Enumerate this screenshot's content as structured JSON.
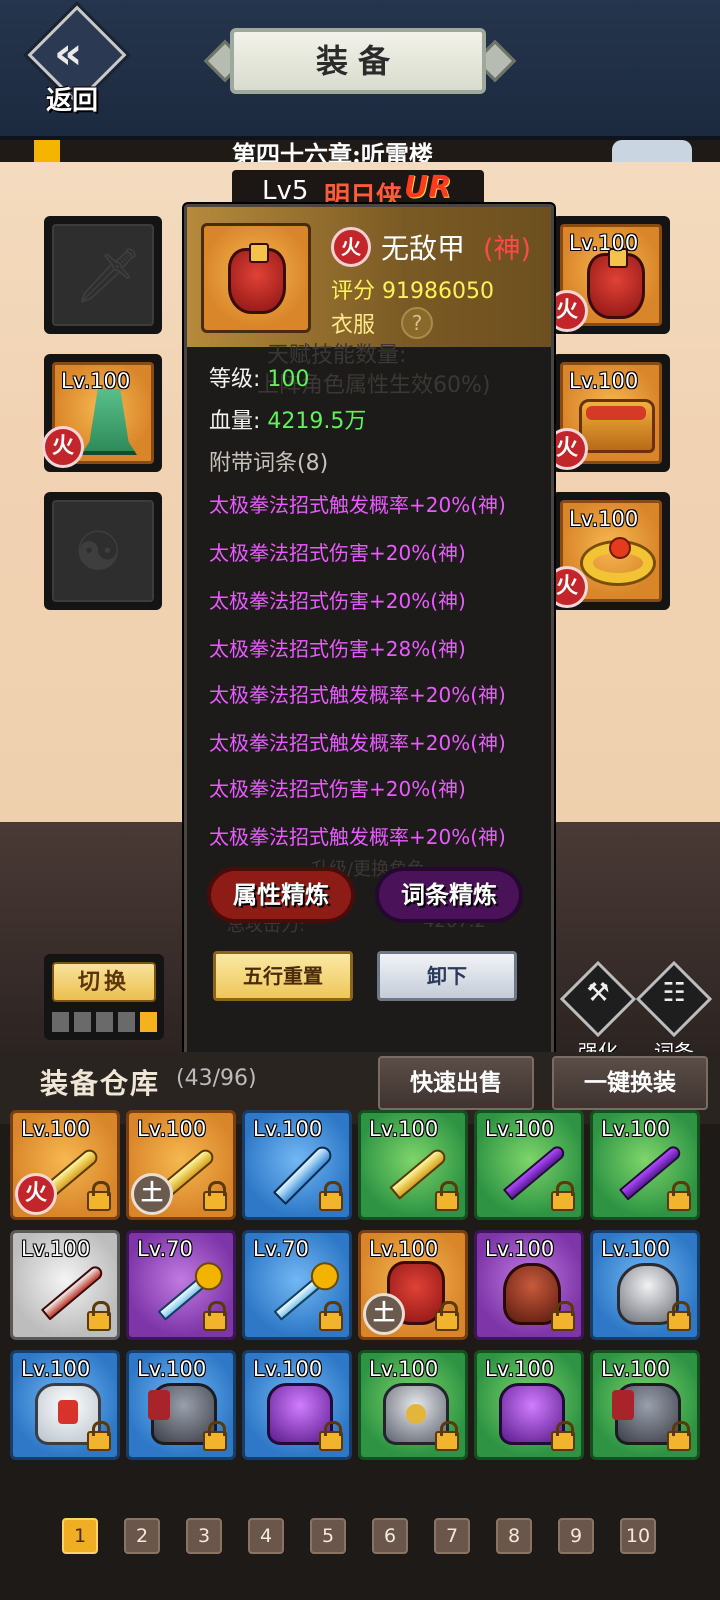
{
  "header": {
    "back_label": "返回",
    "title": "装备",
    "chapter_text": "第四十六章:听雷楼"
  },
  "hero": {
    "level": "Lv5",
    "name": "明日侠",
    "rank": "UR"
  },
  "slots": {
    "left": [
      {
        "state": "empty",
        "icon": "dagger-placeholder-icon"
      },
      {
        "state": "filled",
        "level": "Lv.100",
        "icon": "hat-icon",
        "element": "火"
      },
      {
        "state": "empty",
        "icon": "amulet-placeholder-icon"
      }
    ],
    "right": [
      {
        "state": "filled",
        "level": "Lv.100",
        "icon": "armor-icon",
        "element": "火"
      },
      {
        "state": "filled",
        "level": "Lv.100",
        "icon": "boots-icon",
        "element": "火"
      },
      {
        "state": "filled",
        "level": "Lv.100",
        "icon": "ring-icon",
        "element": "火"
      }
    ]
  },
  "detail": {
    "element": "火",
    "name": "无敌甲",
    "grade": "(神)",
    "score_label": "评分",
    "score_value": "91986050",
    "type": "衣服",
    "help": "?",
    "level_label": "等级:",
    "level_value": "100",
    "hp_label": "血量:",
    "hp_value": "4219.5万",
    "ghost_text_1": "天赋技能数量:",
    "ghost_text_2": "上阵角色属性生效60%)",
    "affix_header": "附带词条(8)",
    "affixes": [
      "太极拳法招式触发概率+20%(神)",
      "太极拳法招式伤害+20%(神)",
      "太极拳法招式伤害+20%(神)",
      "太极拳法招式伤害+28%(神)",
      "太极拳法招式触发概率+20%(神)",
      "太极拳法招式触发概率+20%(神)",
      "太极拳法招式伤害+20%(神)",
      "太极拳法招式触发概率+20%(神)"
    ],
    "refine_attr": "属性精炼",
    "refine_affix": "词条精炼",
    "reset_label": "五行重置",
    "unequip_label": "卸下",
    "ghost_text_3": "升级/更换角色",
    "ghost_text_4": "总攻击力:",
    "ghost_text_5": "4207.2"
  },
  "switch": {
    "label": "切换",
    "bars_total": 5,
    "bar_active_index": 4
  },
  "side_buttons": {
    "strengthen": {
      "label": "强化",
      "icon": "hammer-icon"
    },
    "affix": {
      "label": "词条",
      "icon": "grid-icon"
    }
  },
  "warehouse": {
    "title": "装备仓库",
    "count": "(43/96)",
    "quick_sell": "快速出售",
    "one_click_swap": "一键换装"
  },
  "inventory": [
    {
      "level": "Lv.100",
      "quality": "orange",
      "art": "sword",
      "badge": "火",
      "badge_type": "fire"
    },
    {
      "level": "Lv.100",
      "quality": "orange",
      "art": "sword",
      "badge": "土",
      "badge_type": "earth"
    },
    {
      "level": "Lv.100",
      "quality": "blue",
      "art": "crystal"
    },
    {
      "level": "Lv.100",
      "quality": "green",
      "art": "sword"
    },
    {
      "level": "Lv.100",
      "quality": "green",
      "art": "blade"
    },
    {
      "level": "Lv.100",
      "quality": "green",
      "art": "blade"
    },
    {
      "level": "Lv.100",
      "quality": "white",
      "art": "dagger"
    },
    {
      "level": "Lv.70",
      "quality": "purple",
      "art": "ice"
    },
    {
      "level": "Lv.70",
      "quality": "blue",
      "art": "ice"
    },
    {
      "level": "Lv.100",
      "quality": "orange",
      "art": "armor-red",
      "badge": "土",
      "badge_type": "earth"
    },
    {
      "level": "Lv.100",
      "quality": "purple",
      "art": "helm-dark"
    },
    {
      "level": "Lv.100",
      "quality": "blue",
      "art": "helm-silver"
    },
    {
      "level": "Lv.100",
      "quality": "blue",
      "art": "vest-white"
    },
    {
      "level": "Lv.100",
      "quality": "blue",
      "art": "vest-dark"
    },
    {
      "level": "Lv.100",
      "quality": "blue",
      "art": "vest-purple"
    },
    {
      "level": "Lv.100",
      "quality": "green",
      "art": "vest-silver"
    },
    {
      "level": "Lv.100",
      "quality": "green",
      "art": "vest-purple"
    },
    {
      "level": "Lv.100",
      "quality": "green",
      "art": "vest-dark"
    }
  ],
  "pagination": {
    "pages": [
      "1",
      "2",
      "3",
      "4",
      "5",
      "6",
      "7",
      "8",
      "9",
      "10"
    ],
    "active": "1"
  }
}
